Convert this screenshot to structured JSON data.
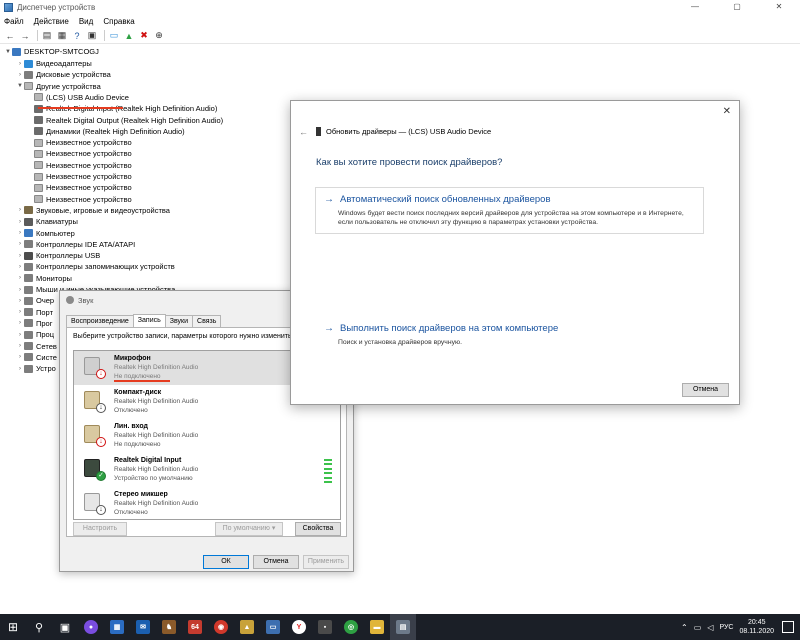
{
  "device_manager": {
    "title": "Диспетчер устройств",
    "window_controls": {
      "minimize": "—",
      "maximize": "▢",
      "close": "✕"
    },
    "menu": [
      "Файл",
      "Действие",
      "Вид",
      "Справка"
    ],
    "tree": {
      "root": "DESKTOP-SMTCOGJ",
      "items": [
        {
          "label": "Видеоадаптеры",
          "level": 1,
          "expanded": false,
          "icon": "display-icon"
        },
        {
          "label": "Дисковые устройства",
          "level": 1,
          "expanded": false,
          "icon": "disk-icon"
        },
        {
          "label": "Другие устройства",
          "level": 1,
          "expanded": true,
          "icon": "unknown-device-icon"
        },
        {
          "label": "(LCS) USB Audio Device",
          "level": 2,
          "icon": "unknown-device-icon"
        },
        {
          "label": "Realtek Digital Input (Realtek High Definition Audio)",
          "level": 2,
          "icon": "audio-icon"
        },
        {
          "label": "Realtek Digital Output (Realtek High Definition Audio)",
          "level": 2,
          "icon": "audio-icon"
        },
        {
          "label": "Динамики (Realtek High Definition Audio)",
          "level": 2,
          "icon": "audio-icon"
        },
        {
          "label": "Неизвестное устройство",
          "level": 2,
          "icon": "unknown-device-icon"
        },
        {
          "label": "Неизвестное устройство",
          "level": 2,
          "icon": "unknown-device-icon"
        },
        {
          "label": "Неизвестное устройство",
          "level": 2,
          "icon": "unknown-device-icon"
        },
        {
          "label": "Неизвестное устройство",
          "level": 2,
          "icon": "unknown-device-icon"
        },
        {
          "label": "Неизвестное устройство",
          "level": 2,
          "icon": "unknown-device-icon"
        },
        {
          "label": "Неизвестное устройство",
          "level": 2,
          "icon": "unknown-device-icon"
        },
        {
          "label": "Звуковые, игровые и видеоустройства",
          "level": 1,
          "expanded": false,
          "icon": "sound-icon"
        },
        {
          "label": "Клавиатуры",
          "level": 1,
          "expanded": false,
          "icon": "keyboard-icon"
        },
        {
          "label": "Компьютер",
          "level": 1,
          "expanded": false,
          "icon": "computer-icon"
        },
        {
          "label": "Контроллеры IDE ATA/ATAPI",
          "level": 1,
          "expanded": false,
          "icon": "ide-icon"
        },
        {
          "label": "Контроллеры USB",
          "level": 1,
          "expanded": false,
          "icon": "usb-icon"
        },
        {
          "label": "Контроллеры запоминающих устройств",
          "level": 1,
          "expanded": false,
          "icon": "storage-icon"
        },
        {
          "label": "Мониторы",
          "level": 1,
          "expanded": false,
          "icon": "monitor-icon"
        },
        {
          "label": "Мыши и иные указывающие устройства",
          "level": 1,
          "expanded": false,
          "icon": "mouse-icon"
        },
        {
          "label": "Очер",
          "level": 1,
          "expanded": false,
          "icon": "queue-icon"
        },
        {
          "label": "Порт",
          "level": 1,
          "expanded": false,
          "icon": "port-icon"
        },
        {
          "label": "Прог",
          "level": 1,
          "expanded": false,
          "icon": "software-icon"
        },
        {
          "label": "Проц",
          "level": 1,
          "expanded": false,
          "icon": "cpu-icon"
        },
        {
          "label": "Сетев",
          "level": 1,
          "expanded": false,
          "icon": "network-icon"
        },
        {
          "label": "Систе",
          "level": 1,
          "expanded": false,
          "icon": "system-icon"
        },
        {
          "label": "Устро",
          "level": 1,
          "expanded": false,
          "icon": "hid-icon"
        }
      ]
    }
  },
  "sound_dialog": {
    "title": "Звук",
    "tabs": [
      "Воспроизведение",
      "Запись",
      "Звуки",
      "Связь"
    ],
    "active_tab": "Запись",
    "instruction": "Выберите устройство записи, параметры которого нужно изменить:",
    "devices": [
      {
        "name": "Микрофон",
        "driver": "Realtek High Definition Audio",
        "status": "Не подключено",
        "badge": "↓"
      },
      {
        "name": "Компакт-диск",
        "driver": "Realtek High Definition Audio",
        "status": "Отключено",
        "badge": "↓"
      },
      {
        "name": "Лин. вход",
        "driver": "Realtek High Definition Audio",
        "status": "Не подключено",
        "badge": "↓"
      },
      {
        "name": "Realtek Digital Input",
        "driver": "Realtek High Definition Audio",
        "status": "Устройство по умолчанию",
        "badge": "✓"
      },
      {
        "name": "Стерео микшер",
        "driver": "Realtek High Definition Audio",
        "status": "Отключено",
        "badge": "↓"
      }
    ],
    "buttons": {
      "configure": "Настроить",
      "default": "По умолчанию",
      "properties": "Свойства",
      "ok": "ОК",
      "cancel": "Отмена",
      "apply": "Применить"
    }
  },
  "update_drivers": {
    "header": "Обновить драйверы — (LCS) USB Audio Device",
    "back_glyph": "←",
    "close_glyph": "✕",
    "question": "Как вы хотите провести поиск драйверов?",
    "option_auto": {
      "title": "Автоматический поиск обновленных драйверов",
      "description": "Windows будет вести поиск последних версий драйверов для устройства на этом компьютере и в Интернете, если пользователь не отключил эту функцию в параметрах установки устройства."
    },
    "option_manual": {
      "title": "Выполнить поиск драйверов на этом компьютере",
      "description": "Поиск и установка драйверов вручную."
    },
    "cancel": "Отмена"
  },
  "taskbar": {
    "language": "РУС",
    "time": "20:45",
    "date": "08.11.2020",
    "badge_64": "64"
  },
  "colors": {
    "accent_link": "#1c55a0",
    "highlight_underline": "#e53b1f",
    "taskbar_bg": "#1b1f27"
  }
}
